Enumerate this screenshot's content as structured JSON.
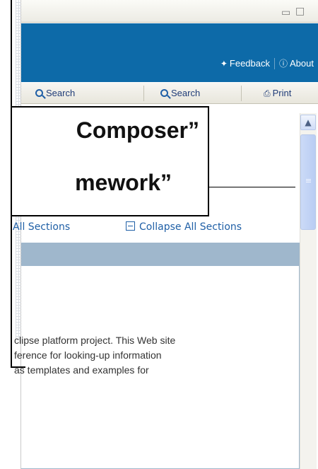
{
  "window": {
    "minimize_icon": "minimize-icon",
    "maximize_icon": "maximize-icon"
  },
  "header": {
    "feedback_label": "Feedback",
    "about_label": "About",
    "color": "#0d6aa8"
  },
  "toolbar": {
    "search1_label": "Search",
    "search2_label": "Search",
    "print_label": "Print"
  },
  "content": {
    "expand_all_label": "All Sections",
    "collapse_all_label": "Collapse All Sections",
    "paragraph_lines": [
      "clipse platform project. This Web site",
      "ference for looking-up information",
      "as templates and examples for"
    ]
  },
  "callout": {
    "line1": "Composer”",
    "line2": "mework”"
  }
}
